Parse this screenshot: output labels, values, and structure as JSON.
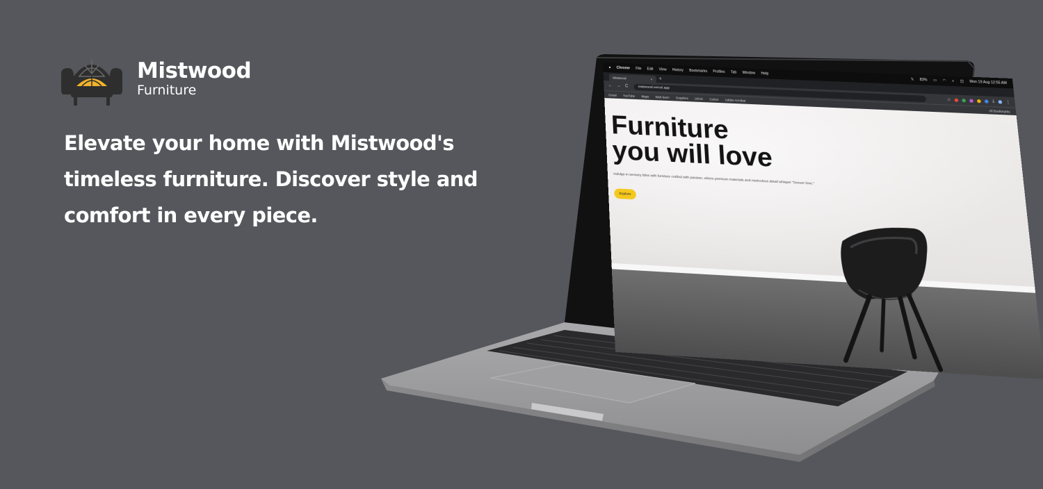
{
  "brand": {
    "name": "Mistwood",
    "sub": "Furniture",
    "logo_icon": "armchair-logo-icon",
    "accent": "#f2b32c"
  },
  "tagline": "Elevate your home with Mistwood's timeless furniture. Discover style and comfort in every piece.",
  "colors": {
    "background": "#55575c",
    "button": "#f4c81d"
  },
  "screen": {
    "menubar": {
      "items": [
        "Chrome",
        "File",
        "Edit",
        "View",
        "History",
        "Bookmarks",
        "Profiles",
        "Tab",
        "Window",
        "Help"
      ],
      "battery": "83%",
      "clock": "Mon 19 Aug  12:55 AM"
    },
    "tab": {
      "title": "Mistwood",
      "close": "×",
      "new_tab": "+"
    },
    "toolbar": {
      "back": "←",
      "forward": "→",
      "reload": "C",
      "url": "mistwood.vercel.app"
    },
    "bookmarks": {
      "items": [
        "Gmail",
        "YouTube",
        "Maps",
        "Web learn",
        "Graphics",
        "UI/UX",
        "Colors",
        "Adobe Acrobat"
      ],
      "all": "All Bookmarks"
    },
    "hero": {
      "title_line1": "Furniture",
      "title_line2": "you will love",
      "description": "Indulge in sensory bliss with furniture crafted with passion, where premium materials and meticulous detail whisper \"forever love.\"",
      "button": "Explore"
    }
  }
}
